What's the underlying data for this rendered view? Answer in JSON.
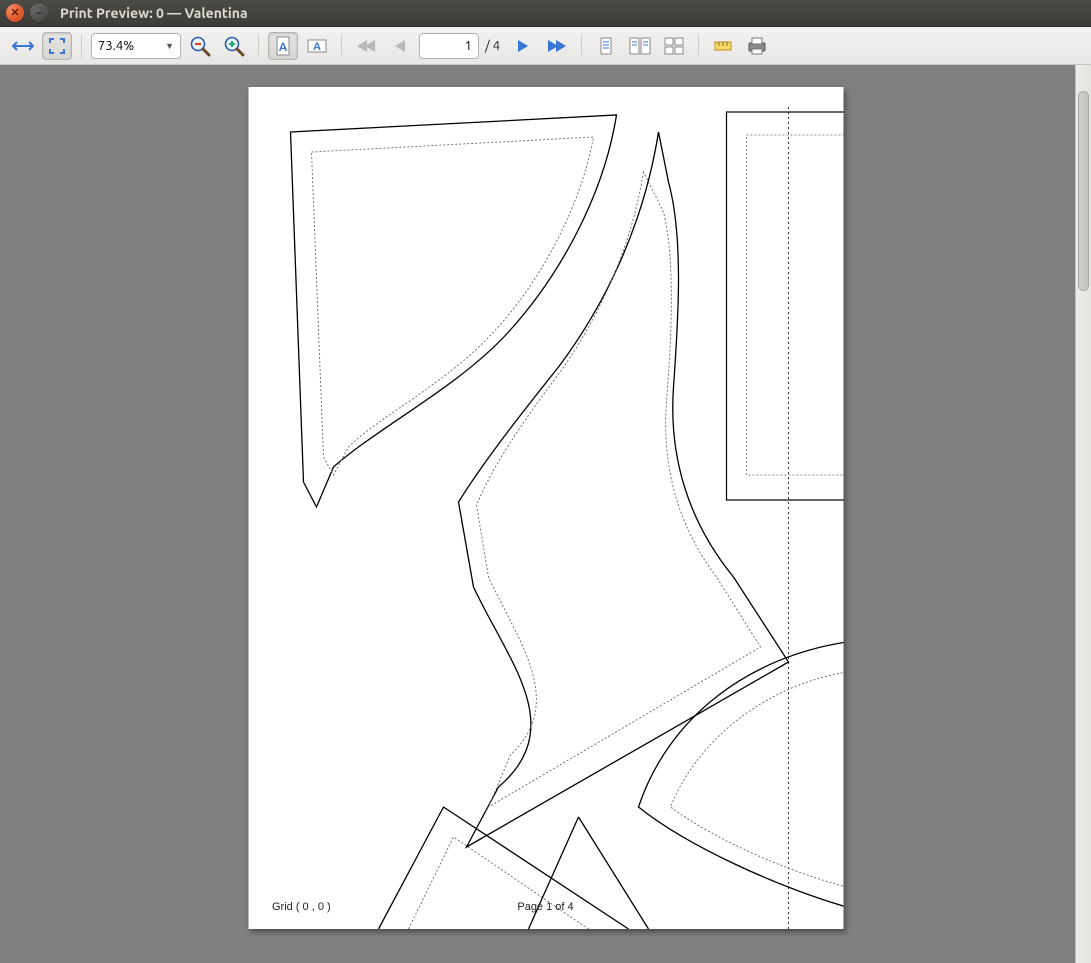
{
  "window": {
    "title": "Print Preview: 0 — Valentina"
  },
  "toolbar": {
    "zoom_value": "73.4%",
    "page_current": "1",
    "page_total": "/ 4"
  },
  "page": {
    "grid_label": "Grid ( 0 , 0 )",
    "page_label": "Page 1 of 4"
  },
  "icons": {
    "close": "✕",
    "minimize": "–"
  }
}
